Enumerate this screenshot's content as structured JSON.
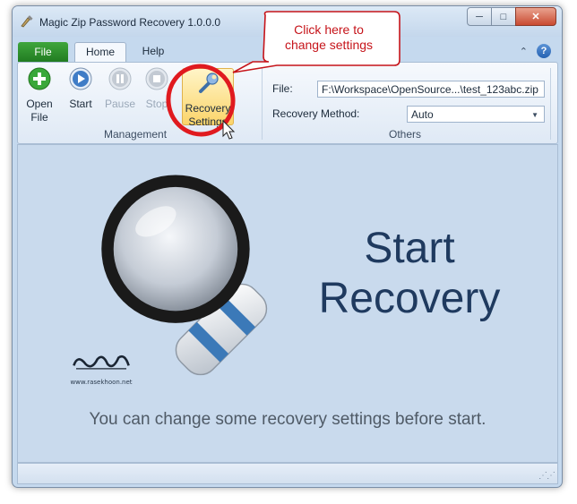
{
  "window": {
    "title": "Magic Zip Password Recovery 1.0.0.0",
    "controls": {
      "minimize": "─",
      "maximize": "□",
      "close": "✕"
    }
  },
  "tabs": [
    {
      "label": "File",
      "active": false
    },
    {
      "label": "Home",
      "active": true
    },
    {
      "label": "Help",
      "active": false
    }
  ],
  "ribbon": {
    "top_icons": {
      "collapse": "⌃",
      "help": "?"
    },
    "buttons": {
      "open_file": "Open\nFile",
      "start": "Start",
      "pause": "Pause",
      "stop": "Stop",
      "recovery_settings": "Recovery\nSettings"
    },
    "groups": {
      "management": "Management",
      "others": "Others"
    },
    "fields": {
      "file_label": "File:",
      "file_value": "F:\\Workspace\\OpenSource...\\test_123abc.zip",
      "method_label": "Recovery Method:",
      "method_value": "Auto"
    }
  },
  "content": {
    "start_line1": "Start",
    "start_line2": "Recovery",
    "hint": "You can change some recovery settings before start.",
    "watermark_url": "www.rasekhoon.net"
  },
  "callout": {
    "line1": "Click here to",
    "line2": "change settings"
  },
  "colors": {
    "accent_red": "#c6141a",
    "title_blue": "#1f3a5f",
    "file_tab_green": "#2f8f2c"
  },
  "icons": {
    "open_file": "plus-circle-icon",
    "start": "play-icon",
    "pause": "pause-icon",
    "stop": "stop-icon",
    "settings": "wrench-icon",
    "magnifier": "magnifier-icon"
  }
}
